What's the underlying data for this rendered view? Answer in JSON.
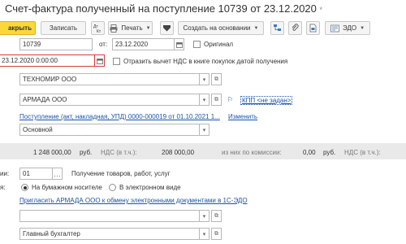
{
  "header": {
    "title": "Счет-фактура полученный на поступление 10739 от 23.12.2020",
    "modified_mark": "*"
  },
  "toolbar": {
    "post_close_label": "акрыть",
    "save_label": "Записать",
    "print_label": "Печать",
    "create_based_label": "Создать на основании",
    "edo_label": "ЭДО"
  },
  "form": {
    "number_value": "10739",
    "from_label": "от:",
    "date_value": "23.12.2020",
    "original_label": "Оригинал",
    "received_value": "23.12.2020  0:00:00",
    "vat_deduction_label": "Отразить вычет НДС в книге покупок датой получения",
    "counterparty_value": "ТЕХНОМИР ООО",
    "contract_value": "АРМАДА ООО",
    "kpp_link": "КПП <не задан>",
    "base_doc_link": "Поступление (акт, накладная, УПД) 0000-000019 от 01.10.2021 1...",
    "change_link": "Изменить",
    "vat_mode_value": "Основной"
  },
  "totals": {
    "amount": "1 248 000,00",
    "amount_unit": "руб.",
    "vat_label": "НДС (в т.ч.):",
    "vat_amount": "208 000,00",
    "commission_label": "из них по комиссии:",
    "commission_amount": "0,00",
    "commission_unit": "руб.",
    "commission_vat_label": "НДС (в т.ч.):"
  },
  "details": {
    "op_code_label": "ии:",
    "op_code_value": "01",
    "op_code_desc": "Получение товаров, работ, услуг",
    "form_label": "я:",
    "paper_label": "На бумажном носителе",
    "electronic_label": "В электронном виде",
    "invite_link": "Пригласить АРМАДА ООО к обмену электронными документами в 1С-ЭДО",
    "manager_value": "",
    "accountant_value": "Главный бухгалтер"
  },
  "colors": {
    "primary_button": "#fcd73a",
    "link": "#1a53a6",
    "error_border": "#d53a3a",
    "totals_bar": "#e9e9e9"
  }
}
